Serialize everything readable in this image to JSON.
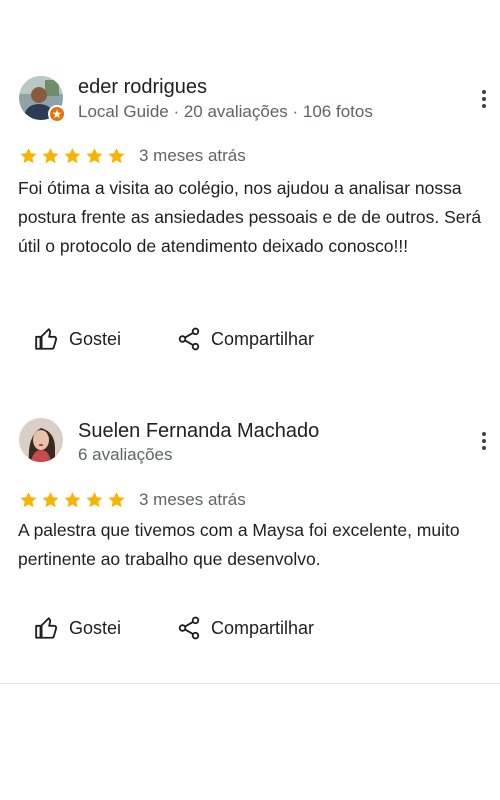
{
  "reviews": [
    {
      "author": "eder rodrigues",
      "meta": "Local Guide · 20 avaliações · 106 fotos",
      "rating": 5,
      "date": "3 meses atrás",
      "text": "Foi ótima a visita ao colégio, nos ajudou a analisar nossa postura frente as ansiedades pessoais e  de de outros. Será útil o protocolo de atendimento deixado conosco!!!",
      "like_label": "Gostei",
      "share_label": "Compartilhar"
    },
    {
      "author": "Suelen Fernanda Machado",
      "meta": "6 avaliações",
      "rating": 5,
      "date": "3 meses atrás",
      "text": "A palestra que tivemos com a Maysa foi excelente, muito pertinente ao trabalho que desenvolvo.",
      "like_label": "Gostei",
      "share_label": "Compartilhar"
    }
  ],
  "colors": {
    "star": "#f4b400",
    "meta_text": "#5f6368",
    "primary_text": "#1f1f1f",
    "local_guide_badge": "#e8710a"
  },
  "icons": {
    "like": "thumb-up-outline-icon",
    "share": "share-icon",
    "more": "more-vert-icon",
    "star": "star-filled-icon",
    "badge": "local-guide-badge-icon"
  }
}
